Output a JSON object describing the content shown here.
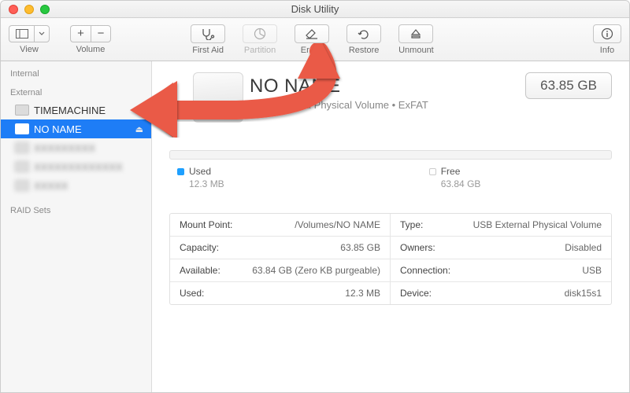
{
  "window": {
    "title": "Disk Utility"
  },
  "toolbar": {
    "view_label": "View",
    "volume_label": "Volume",
    "first_aid": "First Aid",
    "partition": "Partition",
    "erase": "Erase",
    "restore": "Restore",
    "unmount": "Unmount",
    "info": "Info"
  },
  "sidebar": {
    "internal_header": "Internal",
    "external_header": "External",
    "raid_header": "RAID Sets",
    "items": [
      {
        "label": "TIMEMACHINE"
      },
      {
        "label": "NO NAME"
      }
    ]
  },
  "volume": {
    "name": "NO NAME",
    "subtitle": "USB External Physical Volume • ExFAT",
    "capacity_button": "63.85 GB"
  },
  "usage": {
    "used_label": "Used",
    "used_value": "12.3 MB",
    "free_label": "Free",
    "free_value": "63.84 GB"
  },
  "details": {
    "mount_point_l": "Mount Point:",
    "mount_point_v": "/Volumes/NO NAME",
    "type_l": "Type:",
    "type_v": "USB External Physical Volume",
    "capacity_l": "Capacity:",
    "capacity_v": "63.85 GB",
    "owners_l": "Owners:",
    "owners_v": "Disabled",
    "available_l": "Available:",
    "available_v": "63.84 GB (Zero KB purgeable)",
    "connection_l": "Connection:",
    "connection_v": "USB",
    "used_l": "Used:",
    "used_v": "12.3 MB",
    "device_l": "Device:",
    "device_v": "disk15s1"
  }
}
